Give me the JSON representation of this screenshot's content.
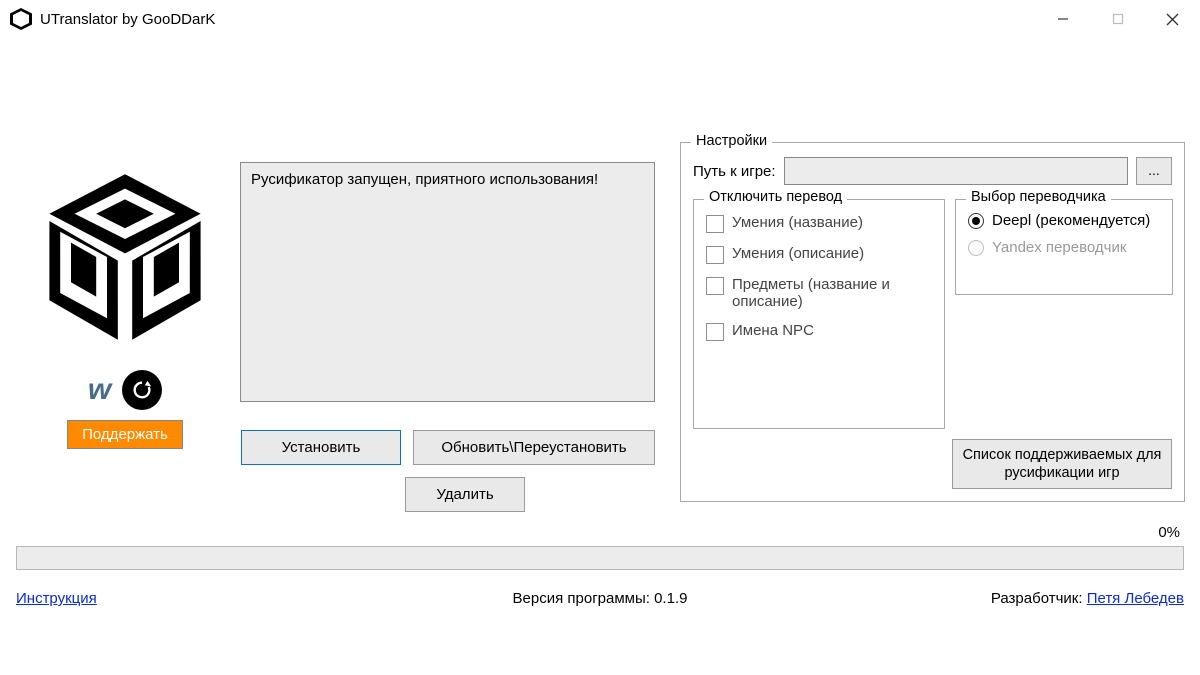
{
  "title": "UTranslator by GooDDarK",
  "status_text": "Русификатор запущен, приятного использования!",
  "buttons": {
    "install": "Установить",
    "update": "Обновить\\Переустановить",
    "delete": "Удалить",
    "support": "Поддержать",
    "browse": "...",
    "supported_list": "Список поддерживаемых для русификации игр"
  },
  "settings": {
    "title": "Настройки",
    "path_label": "Путь к игре:",
    "path_value": "",
    "disable_group": {
      "title": "Отключить перевод",
      "items": [
        "Умения (название)",
        "Умения (описание)",
        "Предметы (название и описание)",
        "Имена NPC"
      ]
    },
    "translator_group": {
      "title": "Выбор переводчика",
      "options": [
        {
          "label": "Deepl (рекомендуется)",
          "selected": true
        },
        {
          "label": "Yandex переводчик",
          "selected": false,
          "disabled": true
        }
      ]
    }
  },
  "progress": {
    "percent_label": "0%"
  },
  "footer": {
    "instruction": "Инструкция",
    "version": "Версия программы: 0.1.9",
    "developer_label": "Разработчик: ",
    "developer_name": "Петя Лебедев"
  }
}
